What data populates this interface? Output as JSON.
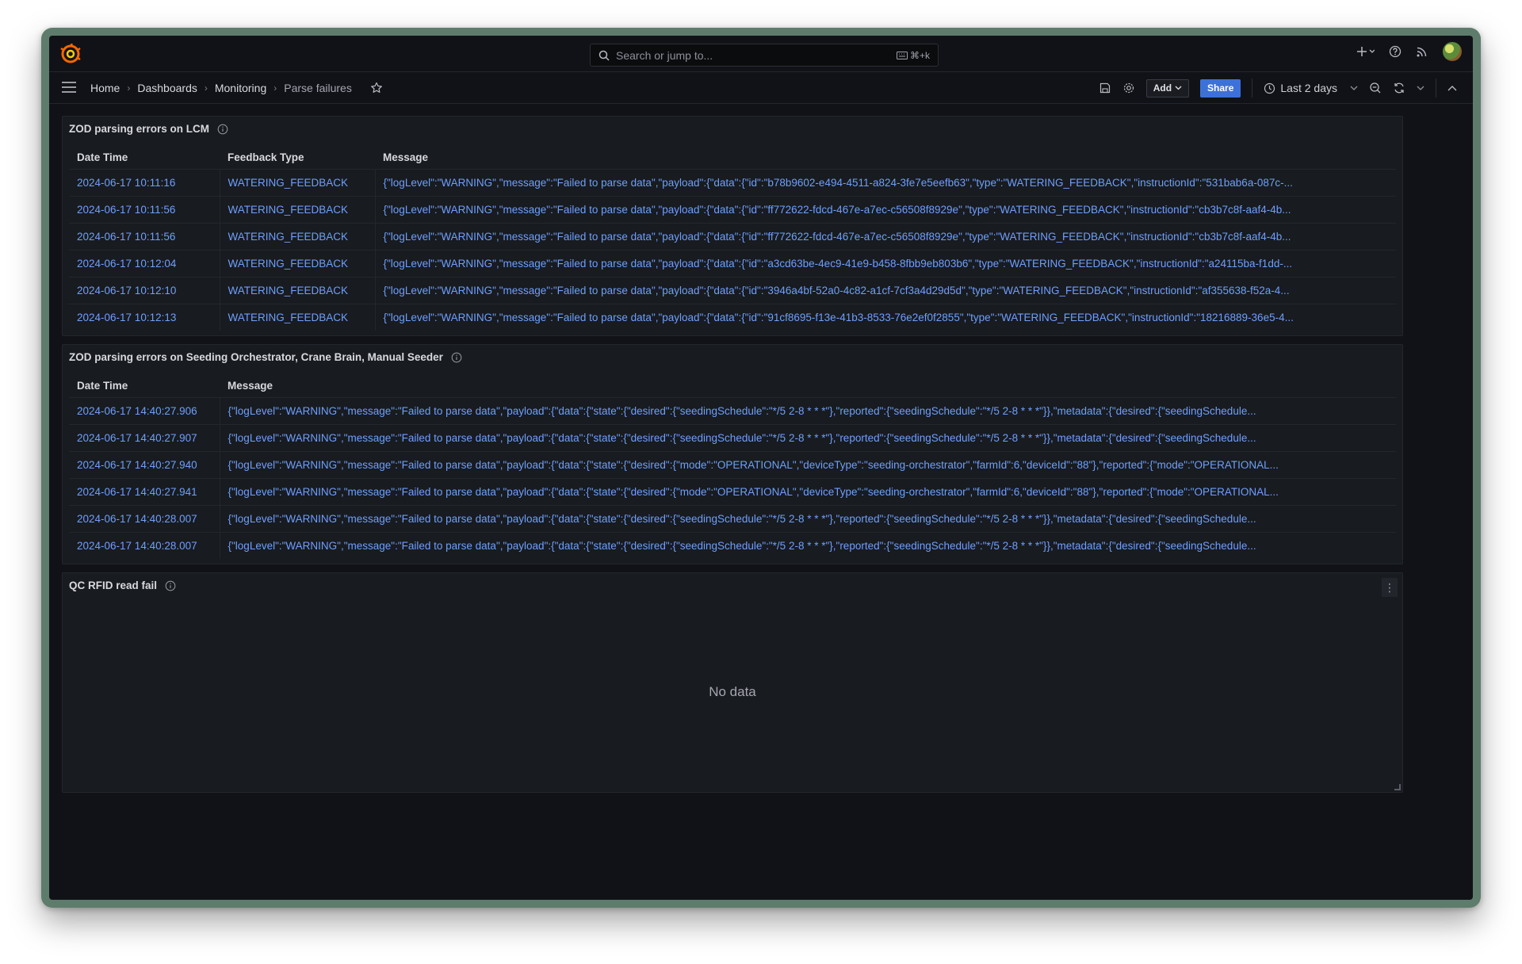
{
  "search": {
    "placeholder": "Search or jump to...",
    "shortcut": "⌘+k"
  },
  "breadcrumb": {
    "items": [
      "Home",
      "Dashboards",
      "Monitoring",
      "Parse failures"
    ],
    "separator": "›"
  },
  "toolbar": {
    "add_label": "Add",
    "share_label": "Share",
    "time_range": "Last 2 days"
  },
  "panels": {
    "lcm": {
      "title": "ZOD parsing errors on LCM",
      "columns": [
        "Date Time",
        "Feedback Type",
        "Message"
      ],
      "rows": [
        [
          "2024-06-17 10:11:16",
          "WATERING_FEEDBACK",
          "{\"logLevel\":\"WARNING\",\"message\":\"Failed to parse data\",\"payload\":{\"data\":{\"id\":\"b78b9602-e494-4511-a824-3fe7e5eefb63\",\"type\":\"WATERING_FEEDBACK\",\"instructionId\":\"531bab6a-087c-..."
        ],
        [
          "2024-06-17 10:11:56",
          "WATERING_FEEDBACK",
          "{\"logLevel\":\"WARNING\",\"message\":\"Failed to parse data\",\"payload\":{\"data\":{\"id\":\"ff772622-fdcd-467e-a7ec-c56508f8929e\",\"type\":\"WATERING_FEEDBACK\",\"instructionId\":\"cb3b7c8f-aaf4-4b..."
        ],
        [
          "2024-06-17 10:11:56",
          "WATERING_FEEDBACK",
          "{\"logLevel\":\"WARNING\",\"message\":\"Failed to parse data\",\"payload\":{\"data\":{\"id\":\"ff772622-fdcd-467e-a7ec-c56508f8929e\",\"type\":\"WATERING_FEEDBACK\",\"instructionId\":\"cb3b7c8f-aaf4-4b..."
        ],
        [
          "2024-06-17 10:12:04",
          "WATERING_FEEDBACK",
          "{\"logLevel\":\"WARNING\",\"message\":\"Failed to parse data\",\"payload\":{\"data\":{\"id\":\"a3cd63be-4ec9-41e9-b458-8fbb9eb803b6\",\"type\":\"WATERING_FEEDBACK\",\"instructionId\":\"a24115ba-f1dd-..."
        ],
        [
          "2024-06-17 10:12:10",
          "WATERING_FEEDBACK",
          "{\"logLevel\":\"WARNING\",\"message\":\"Failed to parse data\",\"payload\":{\"data\":{\"id\":\"3946a4bf-52a0-4c82-a1cf-7cf3a4d29d5d\",\"type\":\"WATERING_FEEDBACK\",\"instructionId\":\"af355638-f52a-4..."
        ],
        [
          "2024-06-17 10:12:13",
          "WATERING_FEEDBACK",
          "{\"logLevel\":\"WARNING\",\"message\":\"Failed to parse data\",\"payload\":{\"data\":{\"id\":\"91cf8695-f13e-41b3-8533-76e2ef0f2855\",\"type\":\"WATERING_FEEDBACK\",\"instructionId\":\"18216889-36e5-4..."
        ]
      ]
    },
    "seeding": {
      "title": "ZOD parsing errors on Seeding Orchestrator, Crane Brain, Manual Seeder",
      "columns": [
        "Date Time",
        "Message"
      ],
      "rows": [
        [
          "2024-06-17 14:40:27.906",
          "{\"logLevel\":\"WARNING\",\"message\":\"Failed to parse data\",\"payload\":{\"data\":{\"state\":{\"desired\":{\"seedingSchedule\":\"*/5 2-8 * * *\"},\"reported\":{\"seedingSchedule\":\"*/5 2-8 * * *\"}},\"metadata\":{\"desired\":{\"seedingSchedule..."
        ],
        [
          "2024-06-17 14:40:27.907",
          "{\"logLevel\":\"WARNING\",\"message\":\"Failed to parse data\",\"payload\":{\"data\":{\"state\":{\"desired\":{\"seedingSchedule\":\"*/5 2-8 * * *\"},\"reported\":{\"seedingSchedule\":\"*/5 2-8 * * *\"}},\"metadata\":{\"desired\":{\"seedingSchedule..."
        ],
        [
          "2024-06-17 14:40:27.940",
          "{\"logLevel\":\"WARNING\",\"message\":\"Failed to parse data\",\"payload\":{\"data\":{\"state\":{\"desired\":{\"mode\":\"OPERATIONAL\",\"deviceType\":\"seeding-orchestrator\",\"farmId\":6,\"deviceId\":\"88\"},\"reported\":{\"mode\":\"OPERATIONAL..."
        ],
        [
          "2024-06-17 14:40:27.941",
          "{\"logLevel\":\"WARNING\",\"message\":\"Failed to parse data\",\"payload\":{\"data\":{\"state\":{\"desired\":{\"mode\":\"OPERATIONAL\",\"deviceType\":\"seeding-orchestrator\",\"farmId\":6,\"deviceId\":\"88\"},\"reported\":{\"mode\":\"OPERATIONAL..."
        ],
        [
          "2024-06-17 14:40:28.007",
          "{\"logLevel\":\"WARNING\",\"message\":\"Failed to parse data\",\"payload\":{\"data\":{\"state\":{\"desired\":{\"seedingSchedule\":\"*/5 2-8 * * *\"},\"reported\":{\"seedingSchedule\":\"*/5 2-8 * * *\"}},\"metadata\":{\"desired\":{\"seedingSchedule..."
        ],
        [
          "2024-06-17 14:40:28.007",
          "{\"logLevel\":\"WARNING\",\"message\":\"Failed to parse data\",\"payload\":{\"data\":{\"state\":{\"desired\":{\"seedingSchedule\":\"*/5 2-8 * * *\"},\"reported\":{\"seedingSchedule\":\"*/5 2-8 * * *\"}},\"metadata\":{\"desired\":{\"seedingSchedule..."
        ]
      ]
    },
    "rfid": {
      "title": "QC RFID read fail",
      "empty_text": "No data"
    }
  },
  "colors": {
    "background": "#111217",
    "panel": "#181b1f",
    "link": "#6e9fff",
    "primary_button": "#3d71d9",
    "logo": "#f46800"
  }
}
